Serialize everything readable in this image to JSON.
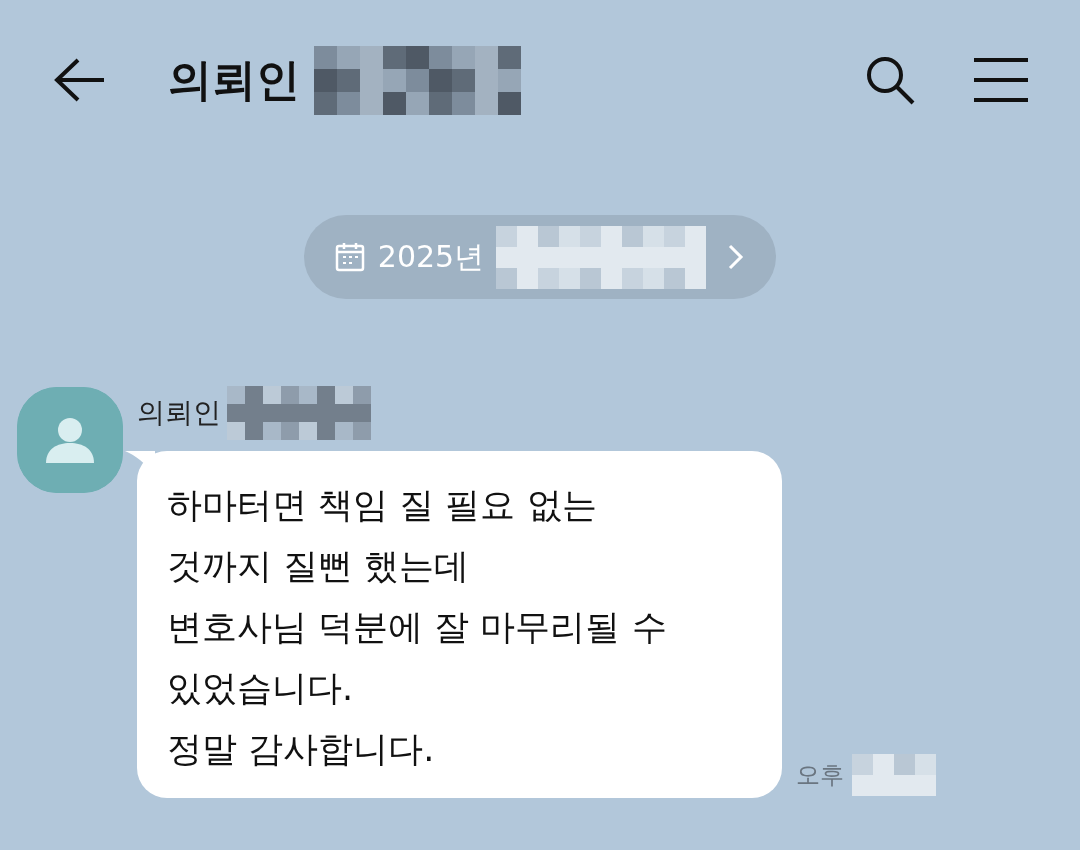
{
  "header": {
    "title": "의뢰인"
  },
  "date_pill": {
    "label": "2025년"
  },
  "message": {
    "sender": "의뢰인",
    "text": "하마터면 책임 질 필요 없는\n것까지 질뻔 했는데\n변호사님 덕분에 잘 마무리될 수\n있었습니다.\n정말 감사합니다.",
    "time": "오후"
  }
}
